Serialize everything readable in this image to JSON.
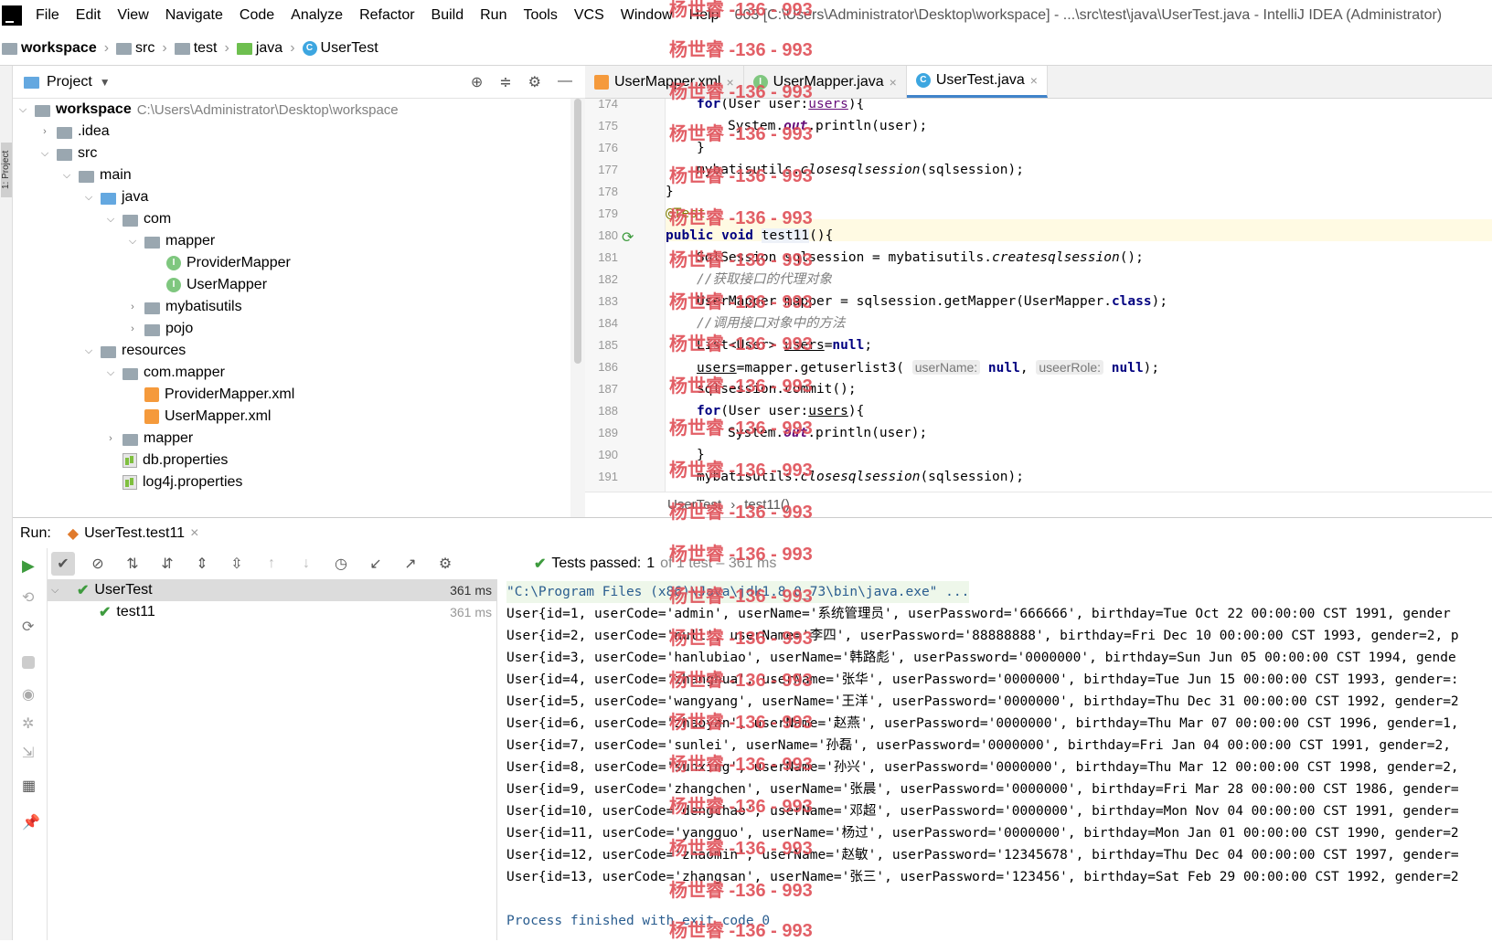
{
  "menu": {
    "items": [
      "File",
      "Edit",
      "View",
      "Navigate",
      "Code",
      "Analyze",
      "Refactor",
      "Build",
      "Run",
      "Tools",
      "VCS",
      "Window",
      "Help"
    ],
    "title": "003 [C:\\Users\\Administrator\\Desktop\\workspace] - ...\\src\\test\\java\\UserTest.java - IntelliJ IDEA (Administrator)"
  },
  "breadcrumb": [
    "workspace",
    "src",
    "test",
    "java",
    "UserTest"
  ],
  "project_panel": {
    "title": "Project",
    "tree": [
      {
        "label": "workspace",
        "dim": "C:\\Users\\Administrator\\Desktop\\workspace",
        "icon": "folder",
        "expanded": true
      },
      {
        "label": ".idea",
        "icon": "folder",
        "expanded": false
      },
      {
        "label": "src",
        "icon": "folder",
        "expanded": true
      },
      {
        "label": "main",
        "icon": "folder",
        "expanded": true
      },
      {
        "label": "java",
        "icon": "folder-blue",
        "expanded": true
      },
      {
        "label": "com",
        "icon": "folder",
        "expanded": true
      },
      {
        "label": "mapper",
        "icon": "folder",
        "expanded": true
      },
      {
        "label": "ProviderMapper",
        "icon": "interface"
      },
      {
        "label": "UserMapper",
        "icon": "interface"
      },
      {
        "label": "mybatisutils",
        "icon": "folder",
        "expanded": false
      },
      {
        "label": "pojo",
        "icon": "folder",
        "expanded": false
      },
      {
        "label": "resources",
        "icon": "folder-resources",
        "expanded": true
      },
      {
        "label": "com.mapper",
        "icon": "folder",
        "expanded": true
      },
      {
        "label": "ProviderMapper.xml",
        "icon": "xml"
      },
      {
        "label": "UserMapper.xml",
        "icon": "xml"
      },
      {
        "label": "mapper",
        "icon": "folder",
        "expanded": false
      },
      {
        "label": "db.properties",
        "icon": "properties"
      },
      {
        "label": "log4j.properties",
        "icon": "properties"
      }
    ]
  },
  "editor": {
    "tabs": [
      {
        "label": "UserMapper.xml",
        "icon": "xml",
        "active": false
      },
      {
        "label": "UserMapper.java",
        "icon": "interface",
        "active": false
      },
      {
        "label": "UserTest.java",
        "icon": "class",
        "active": true
      }
    ],
    "line_numbers": [
      "174",
      "175",
      "176",
      "177",
      "178",
      "179",
      "180",
      "181",
      "182",
      "183",
      "184",
      "185",
      "186",
      "187",
      "188",
      "189",
      "190",
      "191"
    ],
    "crumbs": [
      "UserTest",
      "test11()"
    ],
    "hints": {
      "userName": "userName:",
      "useerRole": "useerRole:"
    }
  },
  "run": {
    "label": "Run:",
    "tab_label": "UserTest.test11",
    "status_prefix": "Tests passed: ",
    "status_count": "1",
    "status_suffix": " of 1 test – 361 ms",
    "tests": [
      {
        "name": "UserTest",
        "time": "361 ms"
      },
      {
        "name": "test11",
        "time": "361 ms"
      }
    ],
    "console": [
      "\"C:\\Program Files (x86)\\Java\\jdk1.8.0_73\\bin\\java.exe\" ...",
      "User{id=1, userCode='admin', userName='系统管理员', userPassword='666666', birthday=Tue Oct 22 00:00:00 CST 1991, gender",
      "User{id=2, userCode='null', userName='李四', userPassword='88888888', birthday=Fri Dec 10 00:00:00 CST 1993, gender=2, p",
      "User{id=3, userCode='hanlubiao', userName='韩路彪', userPassword='0000000', birthday=Sun Jun 05 00:00:00 CST 1994, gende",
      "User{id=4, userCode='zhanghua', userName='张华', userPassword='0000000', birthday=Tue Jun 15 00:00:00 CST 1993, gender=:",
      "User{id=5, userCode='wangyang', userName='王洋', userPassword='0000000', birthday=Thu Dec 31 00:00:00 CST 1992, gender=2",
      "User{id=6, userCode='zhaoyan', userName='赵燕', userPassword='0000000', birthday=Thu Mar 07 00:00:00 CST 1996, gender=1,",
      "User{id=7, userCode='sunlei', userName='孙磊', userPassword='0000000', birthday=Fri Jan 04 00:00:00 CST 1991, gender=2,",
      "User{id=8, userCode='sunxing', userName='孙兴', userPassword='0000000', birthday=Thu Mar 12 00:00:00 CST 1998, gender=2,",
      "User{id=9, userCode='zhangchen', userName='张晨', userPassword='0000000', birthday=Fri Mar 28 00:00:00 CST 1986, gender=",
      "User{id=10, userCode='dengchao', userName='邓超', userPassword='0000000', birthday=Mon Nov 04 00:00:00 CST 1991, gender=",
      "User{id=11, userCode='yangguo', userName='杨过', userPassword='0000000', birthday=Mon Jan 01 00:00:00 CST 1990, gender=2",
      "User{id=12, userCode='zhaomin', userName='赵敏', userPassword='12345678', birthday=Thu Dec 04 00:00:00 CST 1997, gender=",
      "User{id=13, userCode='zhangsan', userName='张三', userPassword='123456', birthday=Sat Feb 29 00:00:00 CST 1992, gender=2",
      "",
      "Process finished with exit code 0"
    ]
  },
  "watermark": "杨世睿 -136 - 993",
  "colors": {
    "accent": "#4083c9",
    "pass": "#3e9b3e",
    "keyword": "#000080",
    "watermark": "#e0525a"
  }
}
